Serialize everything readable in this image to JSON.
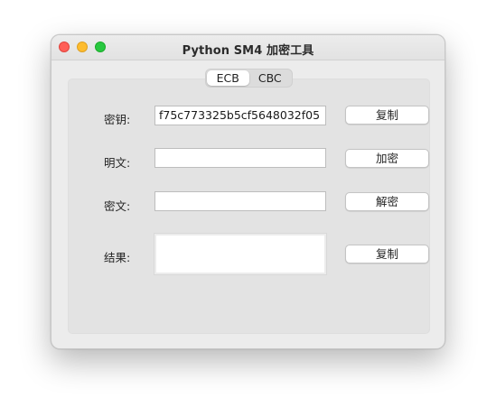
{
  "window": {
    "title": "Python SM4 加密工具"
  },
  "tabs": [
    {
      "label": "ECB",
      "active": true
    },
    {
      "label": "CBC",
      "active": false
    }
  ],
  "form": {
    "key": {
      "label": "密钥:",
      "value": "f75c773325b5cf5648032f05",
      "button": "复制"
    },
    "plaintext": {
      "label": "明文:",
      "value": "",
      "button": "加密"
    },
    "ciphertext": {
      "label": "密文:",
      "value": "",
      "button": "解密"
    },
    "result": {
      "label": "结果:",
      "value": "",
      "button": "复制"
    }
  },
  "colors": {
    "close": "#ff5f57",
    "minimize": "#febc2e",
    "maximize": "#28c840"
  }
}
